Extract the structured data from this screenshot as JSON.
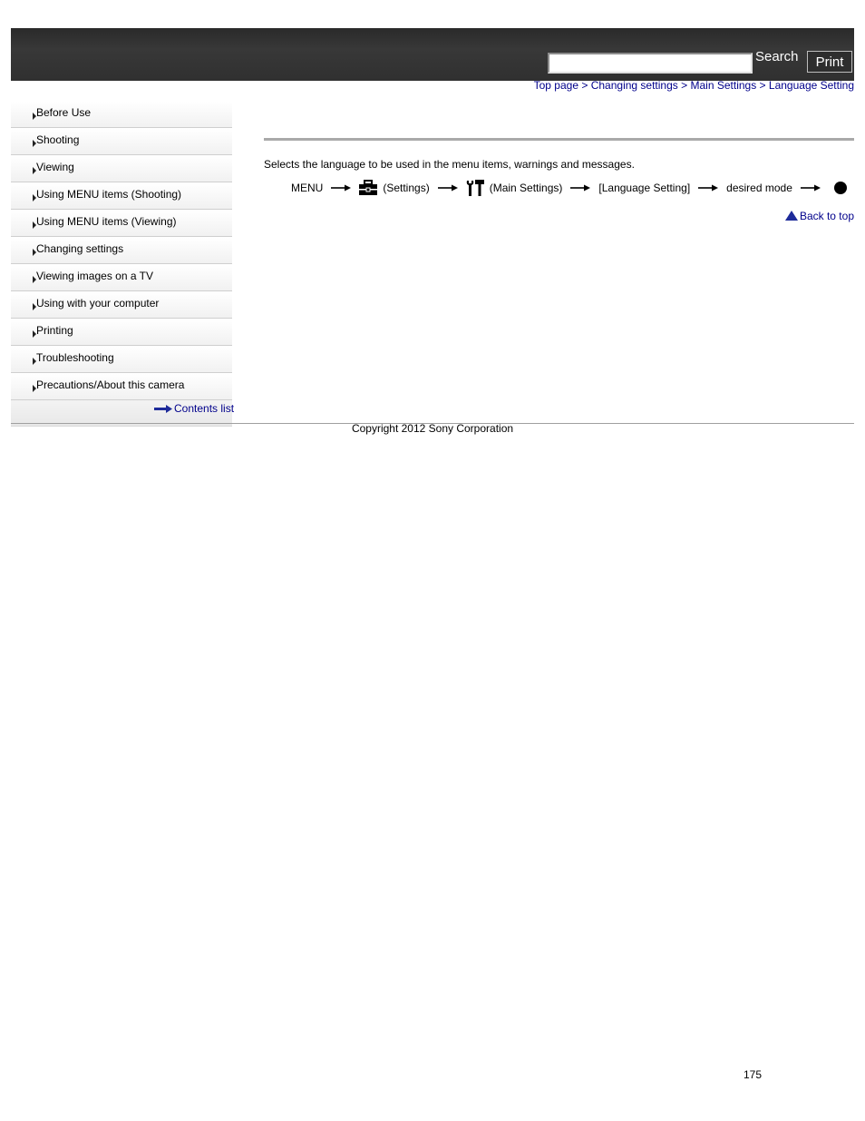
{
  "header": {
    "search_label": "Search",
    "search_value": "",
    "print_label": "Print"
  },
  "breadcrumb": [
    {
      "label": "Top page"
    },
    {
      "label": "Changing settings"
    },
    {
      "label": "Main Settings"
    },
    {
      "label": "Language Setting"
    }
  ],
  "breadcrumb_separator": ">",
  "sidebar": {
    "items": [
      {
        "label": "Before Use"
      },
      {
        "label": "Shooting"
      },
      {
        "label": "Viewing"
      },
      {
        "label": "Using MENU items (Shooting)"
      },
      {
        "label": "Using MENU items (Viewing)"
      },
      {
        "label": "Changing settings"
      },
      {
        "label": "Viewing images on a TV"
      },
      {
        "label": "Using with your computer"
      },
      {
        "label": "Printing"
      },
      {
        "label": "Troubleshooting"
      },
      {
        "label": "Precautions/About this camera"
      }
    ],
    "contents_list": "Contents list"
  },
  "main": {
    "description": "Selects the language to be used in the menu items, warnings and messages.",
    "procedure": {
      "menu": "MENU",
      "settings": "(Settings)",
      "main_settings": "(Main Settings)",
      "language_setting": "[Language Setting]",
      "desired_mode": "desired mode"
    },
    "back_to_top": "Back to top"
  },
  "footer": {
    "copyright": "Copyright 2012 Sony Corporation",
    "page_number": "175"
  },
  "colors": {
    "header_bg": "#333333",
    "link": "#00008b",
    "rule": "#a9a9a9"
  }
}
